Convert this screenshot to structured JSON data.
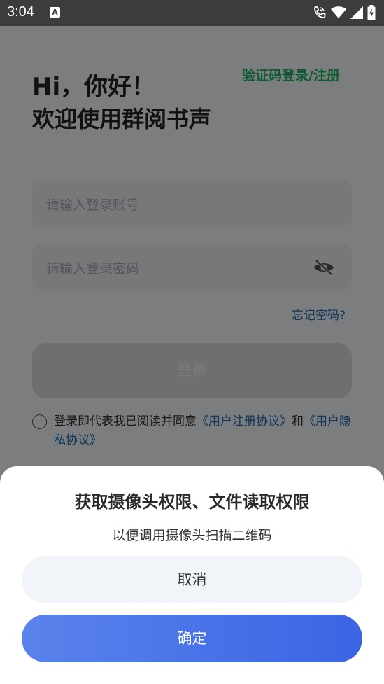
{
  "status_bar": {
    "time": "3:04",
    "notification_icon": "A",
    "icons": [
      "wifi-calling-icon",
      "wifi-icon",
      "signal-icon",
      "battery-charging-icon"
    ]
  },
  "login": {
    "switch_link": "验证码登录/注册",
    "greeting_line1": "Hi，你好！",
    "greeting_line2": "欢迎使用群阅书声",
    "account_placeholder": "请输入登录账号",
    "password_placeholder": "请输入登录密码",
    "password_icon": "eye-hidden-icon",
    "forgot_password": "忘记密码?",
    "login_button": "登录",
    "agreement_prefix": "登录即代表我已阅读并同意",
    "user_agreement": "《用户注册协议》",
    "agreement_and": "和",
    "privacy_policy": "《用户隐私协议》"
  },
  "dialog": {
    "title": "获取摄像头权限、文件读取权限",
    "subtitle": "以便调用摄像头扫描二维码",
    "cancel_label": "取消",
    "confirm_label": "确定"
  },
  "colors": {
    "accent_green": "#19b562",
    "link_blue": "#1e6fb8",
    "confirm_gradient_start": "#5a83ec",
    "confirm_gradient_end": "#3b64e4"
  }
}
